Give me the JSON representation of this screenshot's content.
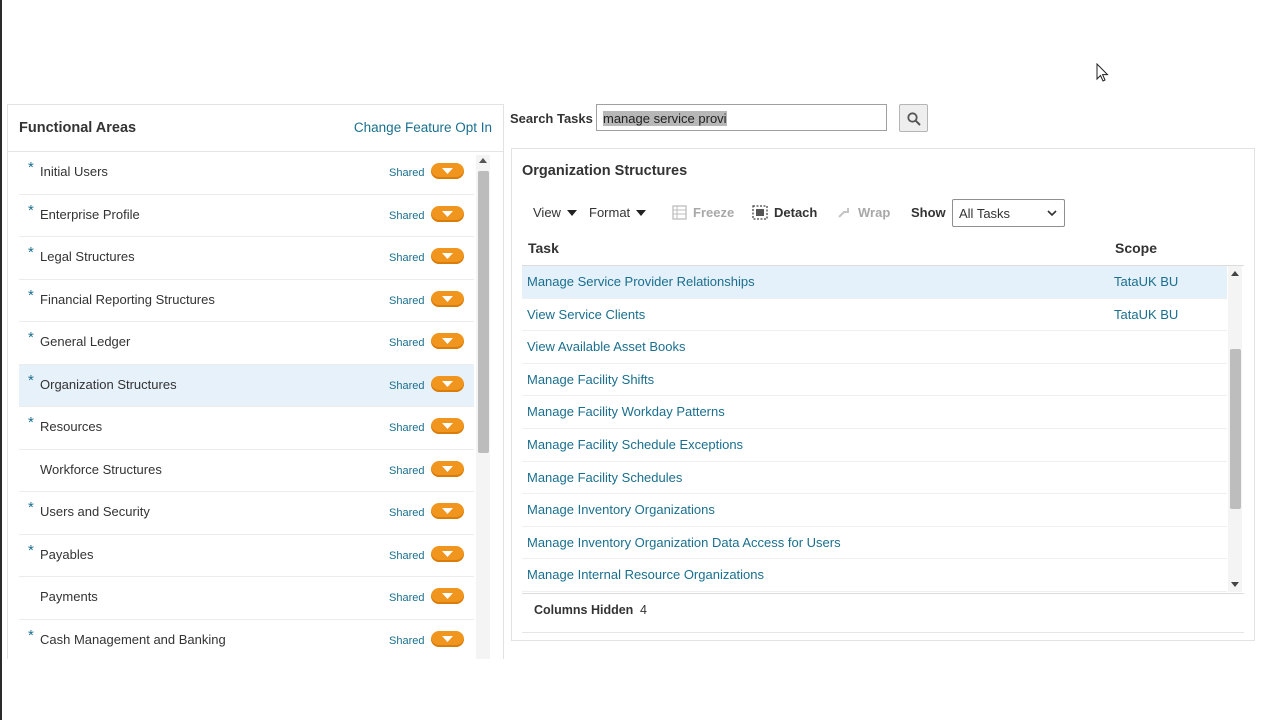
{
  "functional_areas": {
    "title": "Functional Areas",
    "link": "Change Feature Opt In",
    "items": [
      {
        "label": "Initial Users",
        "required": true,
        "shared": "Shared",
        "selected": false
      },
      {
        "label": "Enterprise Profile",
        "required": true,
        "shared": "Shared",
        "selected": false
      },
      {
        "label": "Legal Structures",
        "required": true,
        "shared": "Shared",
        "selected": false
      },
      {
        "label": "Financial Reporting Structures",
        "required": true,
        "shared": "Shared",
        "selected": false
      },
      {
        "label": "General Ledger",
        "required": true,
        "shared": "Shared",
        "selected": false
      },
      {
        "label": "Organization Structures",
        "required": true,
        "shared": "Shared",
        "selected": true
      },
      {
        "label": "Resources",
        "required": true,
        "shared": "Shared",
        "selected": false
      },
      {
        "label": "Workforce Structures",
        "required": false,
        "shared": "Shared",
        "selected": false
      },
      {
        "label": "Users and Security",
        "required": true,
        "shared": "Shared",
        "selected": false
      },
      {
        "label": "Payables",
        "required": true,
        "shared": "Shared",
        "selected": false
      },
      {
        "label": "Payments",
        "required": false,
        "shared": "Shared",
        "selected": false
      },
      {
        "label": "Cash Management and Banking",
        "required": true,
        "shared": "Shared",
        "selected": false
      }
    ]
  },
  "search": {
    "label": "Search Tasks",
    "value": "manage service provi"
  },
  "tasks_panel": {
    "title": "Organization Structures",
    "toolbar": {
      "view": "View",
      "format": "Format",
      "freeze": "Freeze",
      "detach": "Detach",
      "wrap": "Wrap",
      "show_label": "Show",
      "show_value": "All Tasks"
    },
    "columns": {
      "task": "Task",
      "scope": "Scope"
    },
    "rows": [
      {
        "task": "Manage Service Provider Relationships",
        "scope": "TataUK BU",
        "selected": true
      },
      {
        "task": "View Service Clients",
        "scope": "TataUK BU",
        "selected": false
      },
      {
        "task": "View Available Asset Books",
        "scope": "",
        "selected": false
      },
      {
        "task": "Manage Facility Shifts",
        "scope": "",
        "selected": false
      },
      {
        "task": "Manage Facility Workday Patterns",
        "scope": "",
        "selected": false
      },
      {
        "task": "Manage Facility Schedule Exceptions",
        "scope": "",
        "selected": false
      },
      {
        "task": "Manage Facility Schedules",
        "scope": "",
        "selected": false
      },
      {
        "task": "Manage Inventory Organizations",
        "scope": "",
        "selected": false
      },
      {
        "task": "Manage Inventory Organization Data Access for Users",
        "scope": "",
        "selected": false
      },
      {
        "task": "Manage Internal Resource Organizations",
        "scope": "",
        "selected": false
      }
    ],
    "footer": {
      "label": "Columns Hidden",
      "count": "4"
    }
  },
  "colors": {
    "accent_link": "#1a6f8e",
    "pill": "#f0961e",
    "selected_row": "#e4f0fa"
  }
}
